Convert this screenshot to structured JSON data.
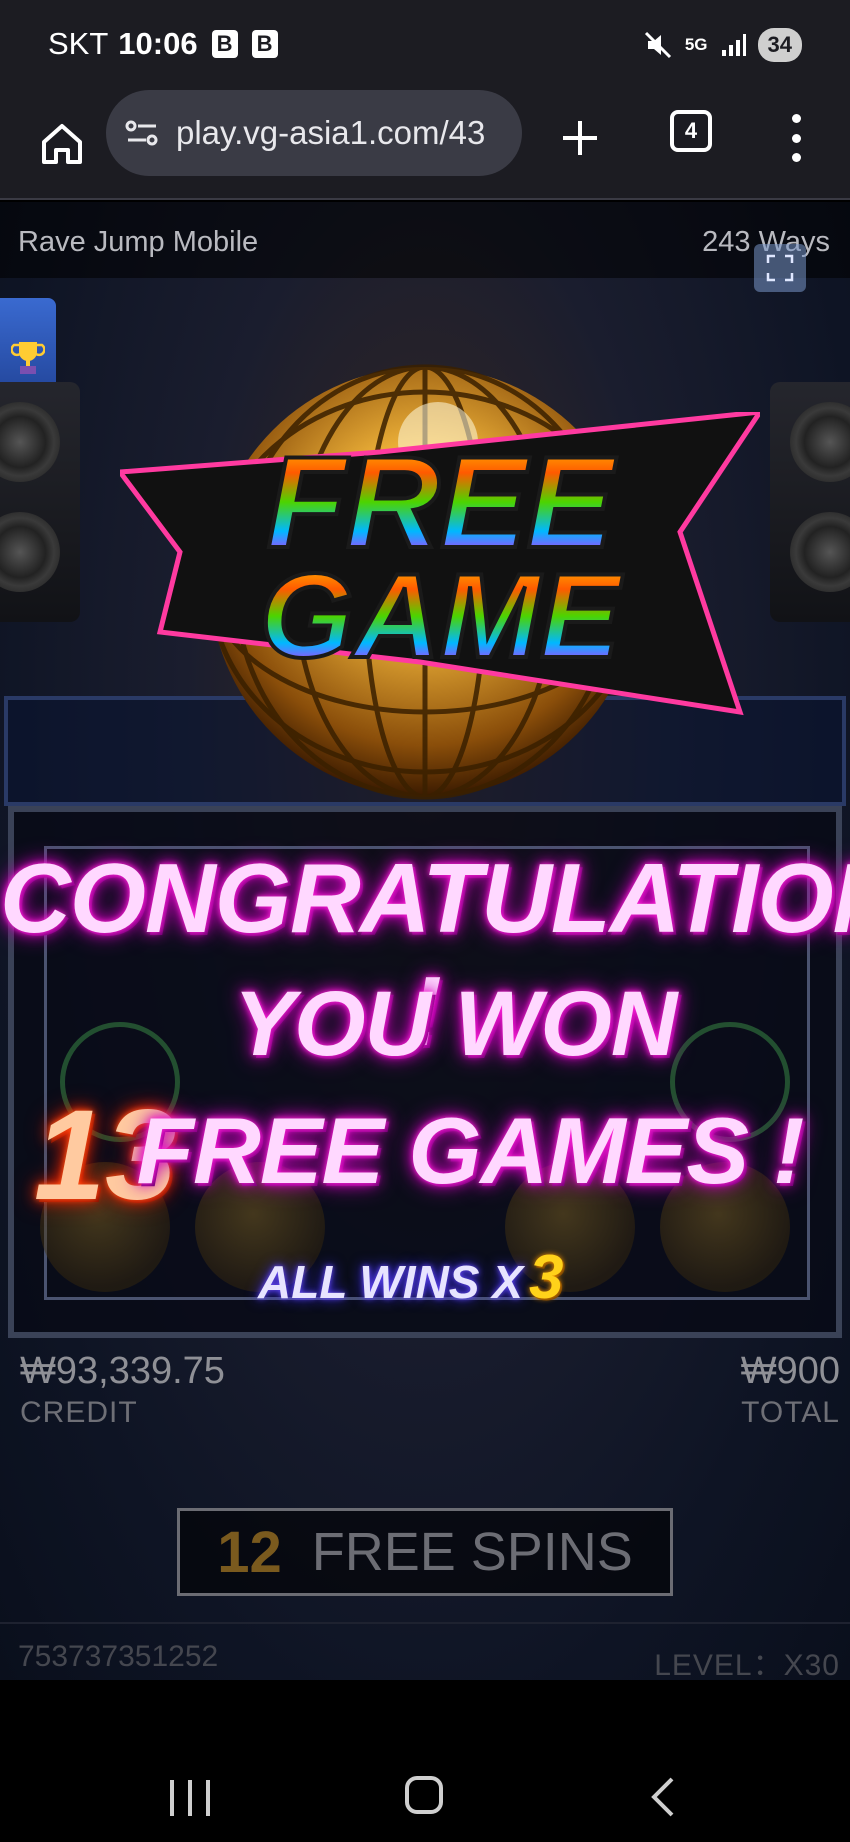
{
  "status_bar": {
    "carrier": "SKT",
    "time": "10:06",
    "notif_icons": [
      "B",
      "B"
    ],
    "network": "5G",
    "battery": "34"
  },
  "browser": {
    "url": "play.vg-asia1.com/43",
    "tab_count": "4"
  },
  "game": {
    "title": "Rave Jump Mobile",
    "ways": "243 Ways",
    "banner_line1": "FREE",
    "banner_line2": "GAME",
    "congrats": "CONGRATULATION !",
    "you_won": "YOU WON",
    "free_games_count": "13",
    "free_games_text": "FREE GAMES !",
    "all_wins_label": "ALL WINS X",
    "all_wins_multiplier": "3",
    "credit_value": "₩93,339.75",
    "credit_label": "CREDIT",
    "total_value": "₩900",
    "total_label": "TOTAL",
    "free_spins_count": "12",
    "free_spins_label": "FREE SPINS",
    "serial": "753737351252",
    "level_label": "LEVEL：X30"
  },
  "colors": {
    "neon_pink": "#ff2bd6",
    "neon_orange": "#ff5a1a",
    "gold": "#ffd21a",
    "browser_bg": "#1c1c22"
  }
}
